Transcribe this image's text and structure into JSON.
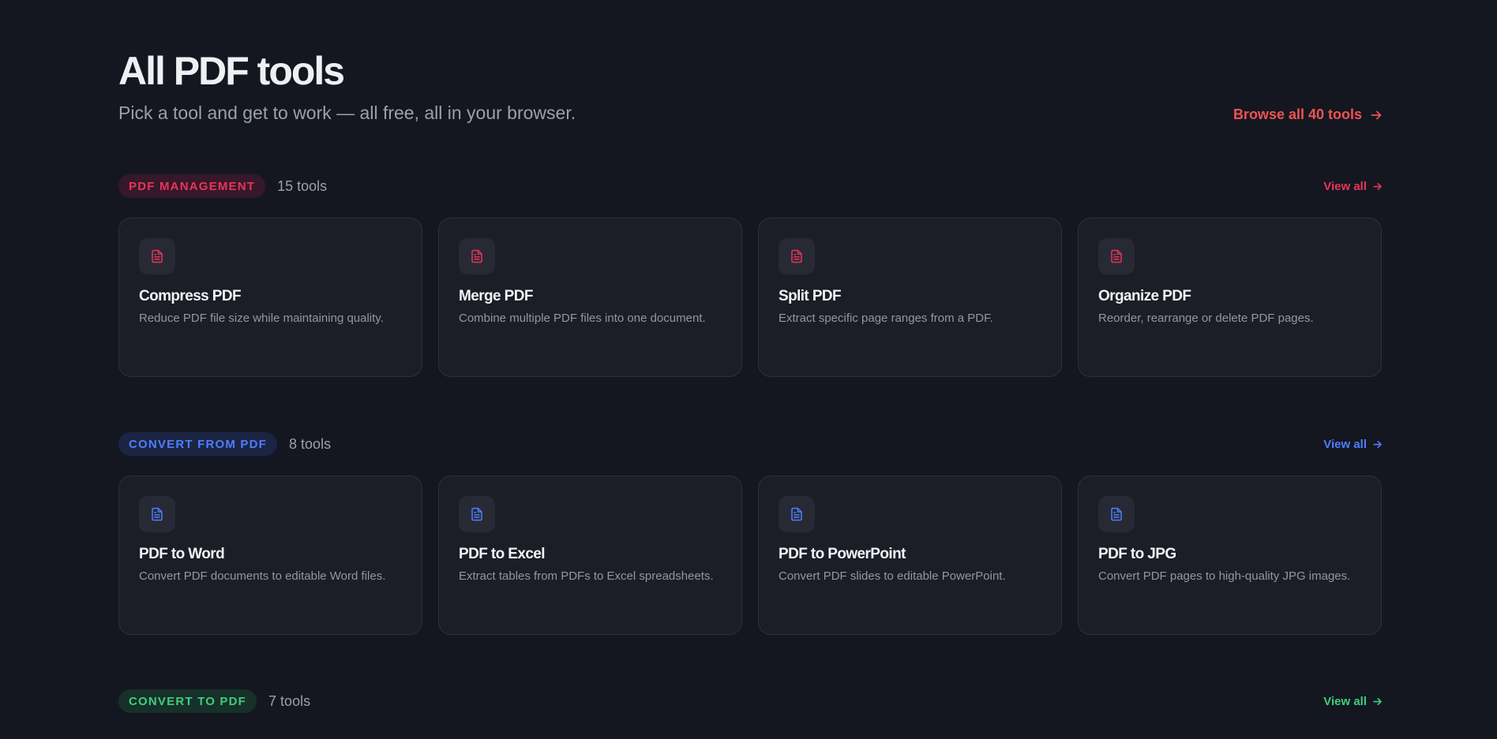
{
  "page": {
    "title": "All PDF tools",
    "subtitle": "Pick a tool and get to work — all free, all in your browser.",
    "browse_all_label": "Browse all 40 tools"
  },
  "sections": [
    {
      "label": "PDF MANAGEMENT",
      "count": "15 tools",
      "view_all": "View all",
      "accent": "#e8345a",
      "badge_bg": "#36182a",
      "icon": "document-icon",
      "tools": [
        {
          "title": "Compress PDF",
          "desc": "Reduce PDF file size while maintaining quality."
        },
        {
          "title": "Merge PDF",
          "desc": "Combine multiple PDF files into one document."
        },
        {
          "title": "Split PDF",
          "desc": "Extract specific page ranges from a PDF."
        },
        {
          "title": "Organize PDF",
          "desc": "Reorder, rearrange or delete PDF pages."
        }
      ]
    },
    {
      "label": "CONVERT FROM PDF",
      "count": "8 tools",
      "view_all": "View all",
      "accent": "#4f7dff",
      "badge_bg": "#1b2442",
      "icon": "document-icon",
      "tools": [
        {
          "title": "PDF to Word",
          "desc": "Convert PDF documents to editable Word files."
        },
        {
          "title": "PDF to Excel",
          "desc": "Extract tables from PDFs to Excel spreadsheets."
        },
        {
          "title": "PDF to PowerPoint",
          "desc": "Convert PDF slides to editable PowerPoint."
        },
        {
          "title": "PDF to JPG",
          "desc": "Convert PDF pages to high-quality JPG images."
        }
      ]
    },
    {
      "label": "CONVERT TO PDF",
      "count": "7 tools",
      "view_all": "View all",
      "accent": "#3ecf7a",
      "badge_bg": "#17302a",
      "tools": []
    }
  ],
  "colors": {
    "background": "#141720",
    "card": "#1b1e27",
    "browse_accent": "#ef5350"
  }
}
